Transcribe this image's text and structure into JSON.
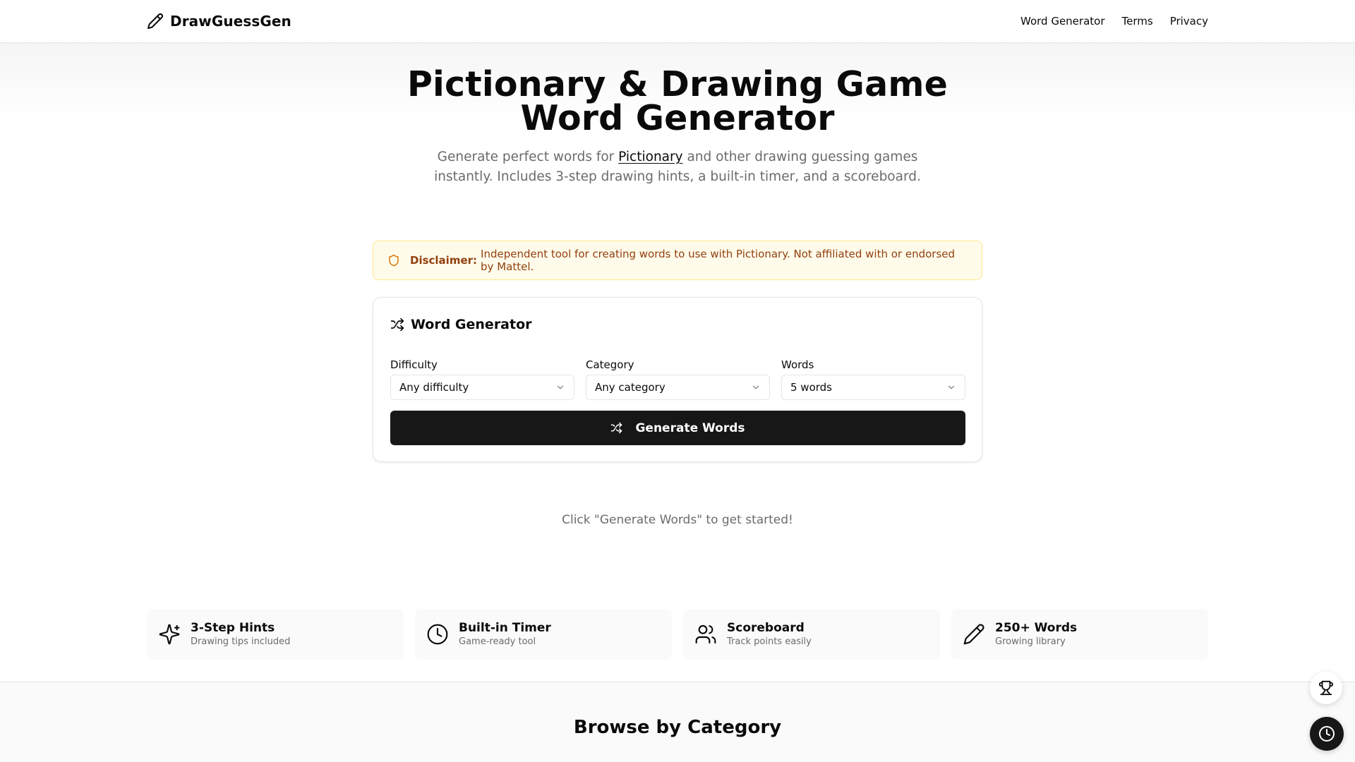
{
  "header": {
    "brand": "DrawGuessGen",
    "brand_icon": "pencil-icon",
    "nav": [
      "Word Generator",
      "Terms",
      "Privacy"
    ]
  },
  "hero": {
    "title": "Pictionary & Drawing Game Word Generator",
    "subtitle_before": "Generate perfect words for ",
    "subtitle_link": "Pictionary",
    "subtitle_after": " and other drawing guessing games instantly. Includes 3-step drawing hints, a built-in timer, and a scoreboard."
  },
  "disclaimer": {
    "icon": "shield-icon",
    "label": "Disclaimer:",
    "text": "Independent tool for creating words to use with Pictionary. Not affiliated with or endorsed by Mattel."
  },
  "generator": {
    "title": "Word Generator",
    "title_icon": "shuffle-icon",
    "fields": [
      {
        "label": "Difficulty",
        "value": "Any difficulty"
      },
      {
        "label": "Category",
        "value": "Any category"
      },
      {
        "label": "Words",
        "value": "5 words"
      }
    ],
    "button": "Generate Words"
  },
  "empty_hint": "Click \"Generate Words\" to get started!",
  "features": [
    {
      "icon": "sparkles-icon",
      "title": "3-Step Hints",
      "subtitle": "Drawing tips included"
    },
    {
      "icon": "clock-icon",
      "title": "Built-in Timer",
      "subtitle": "Game-ready tool"
    },
    {
      "icon": "users-icon",
      "title": "Scoreboard",
      "subtitle": "Track points easily"
    },
    {
      "icon": "pencil-icon",
      "title": "250+ Words",
      "subtitle": "Growing library"
    }
  ],
  "browse": {
    "title": "Browse by Category"
  },
  "floating": {
    "trophy_icon": "trophy-icon",
    "timer_icon": "clock-icon"
  },
  "colors": {
    "primary": "#171717",
    "disclaimer_bg": "#fffbeb",
    "disclaimer_border": "#fde68a",
    "disclaimer_text": "#92400e",
    "muted_text": "#6b6b6b"
  }
}
